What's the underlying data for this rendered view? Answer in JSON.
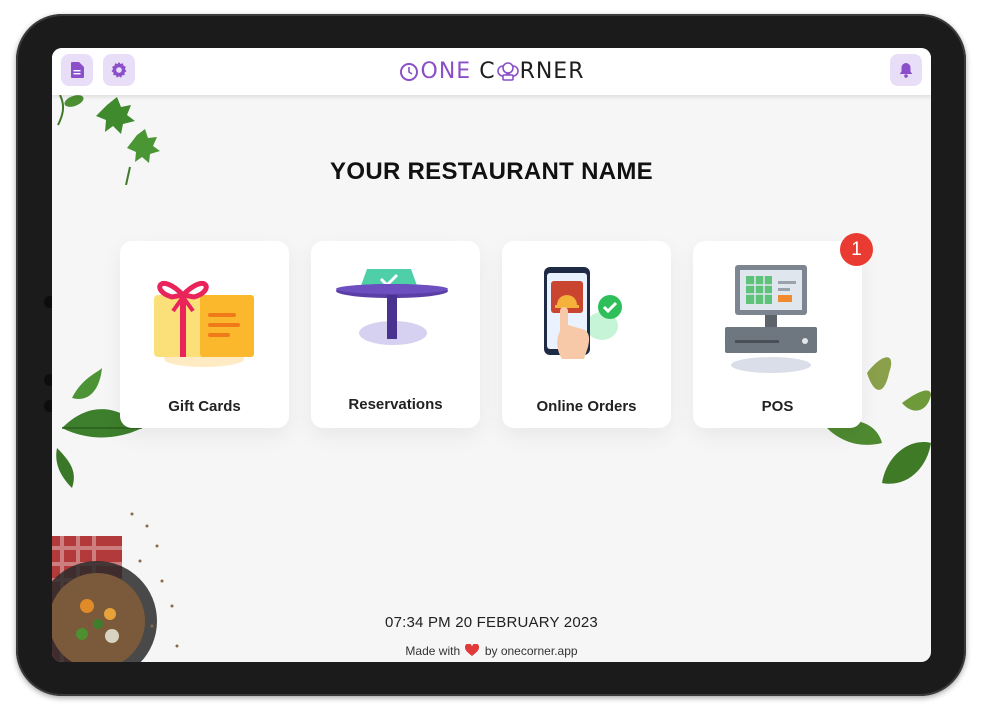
{
  "header": {
    "logo_one": "ONE",
    "logo_corner_start": "C",
    "logo_corner_end": "RNER",
    "left_icons": [
      "document-icon",
      "settings-gear-icon"
    ],
    "right_icon": "bell-icon"
  },
  "main": {
    "restaurant_name": "YOUR RESTAURANT NAME",
    "tiles": [
      {
        "label": "Gift Cards",
        "icon": "gift-card-icon"
      },
      {
        "label": "Reservations",
        "icon": "reserved-table-icon"
      },
      {
        "label": "Online Orders",
        "icon": "phone-order-icon"
      },
      {
        "label": "POS",
        "icon": "cash-register-icon",
        "badge": "1"
      }
    ]
  },
  "footer": {
    "datetime": "07:34 PM 20 FEBRUARY 2023",
    "made_prefix": "Made with",
    "made_suffix": "by onecorner.app"
  },
  "colors": {
    "accent": "#8a4fc9",
    "icon_button_bg": "#e9def8",
    "badge": "#ea3b32",
    "background": "#f6f6f7"
  }
}
